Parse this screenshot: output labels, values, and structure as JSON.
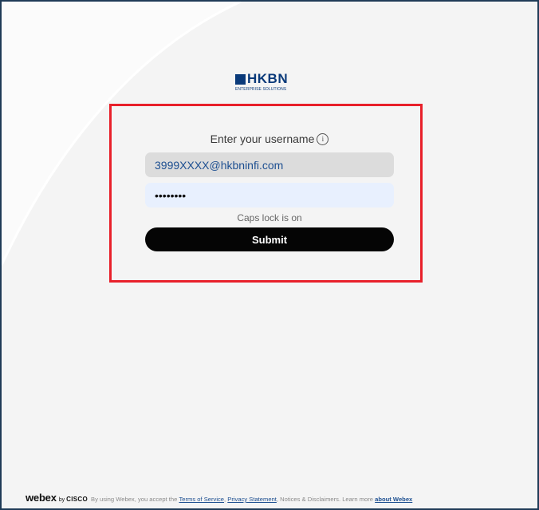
{
  "brand": {
    "logo_word": "HKBN",
    "logo_subtitle": "ENTERPRISE SOLUTIONS"
  },
  "login": {
    "prompt": "Enter your username",
    "username_value": "3999XXXX@hkbninfi.com",
    "password_value": "••••••••",
    "caps_lock_note": "Caps lock is on",
    "submit_label": "Submit"
  },
  "footer": {
    "webex": "webex",
    "by": "by",
    "cisco": "CISCO",
    "text_1": "By using Webex, you accept the",
    "terms_link": "Terms of Service",
    "comma": ",",
    "privacy_link": "Privacy Statement",
    "text_2": ", Notices & Disclaimers. Learn more",
    "about_link": "about Webex"
  },
  "colors": {
    "highlight": "#e8202a",
    "brand_blue": "#0a3a7a",
    "submit_bg": "#050505",
    "link": "#1d4f91"
  }
}
